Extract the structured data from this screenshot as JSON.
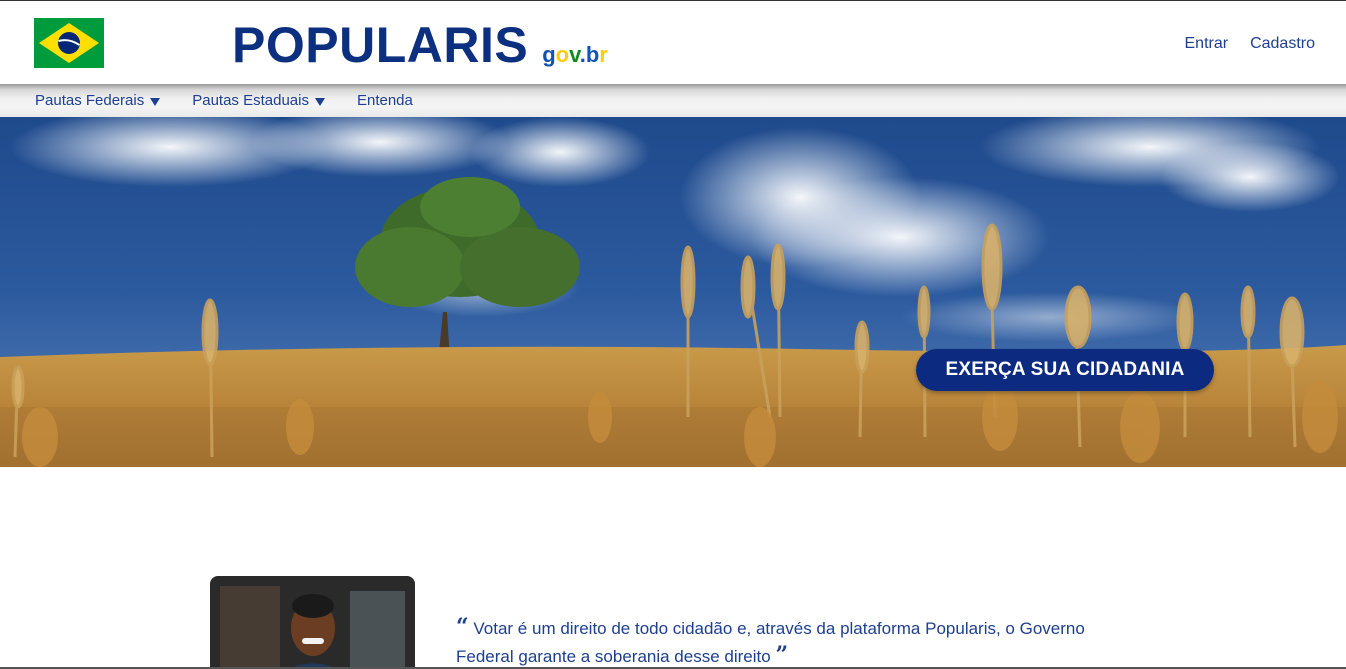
{
  "header": {
    "title": "POPULARIS",
    "gov": {
      "g": "g",
      "o": "o",
      "v": "v",
      "dot": ".",
      "b": "b",
      "r": "r"
    },
    "auth": {
      "login": "Entrar",
      "signup": "Cadastro"
    }
  },
  "nav": {
    "items": [
      {
        "label": "Pautas Federais",
        "icon": "chevron-down-icon"
      },
      {
        "label": "Pautas Estaduais",
        "icon": "chevron-down-icon"
      },
      {
        "label": "Entenda"
      }
    ]
  },
  "hero": {
    "cta_label": "EXERÇA SUA CIDADANIA"
  },
  "testimonial": {
    "open_quote": "“",
    "text": "Votar é um direito de todo cidadão e, através da plataforma Popularis, o Governo Federal garante a soberania desse direito",
    "close_quote": "”"
  },
  "colors": {
    "brand_blue": "#0c2f7f",
    "cta_blue": "#0c2a80",
    "link_blue": "#1e3f8f"
  }
}
